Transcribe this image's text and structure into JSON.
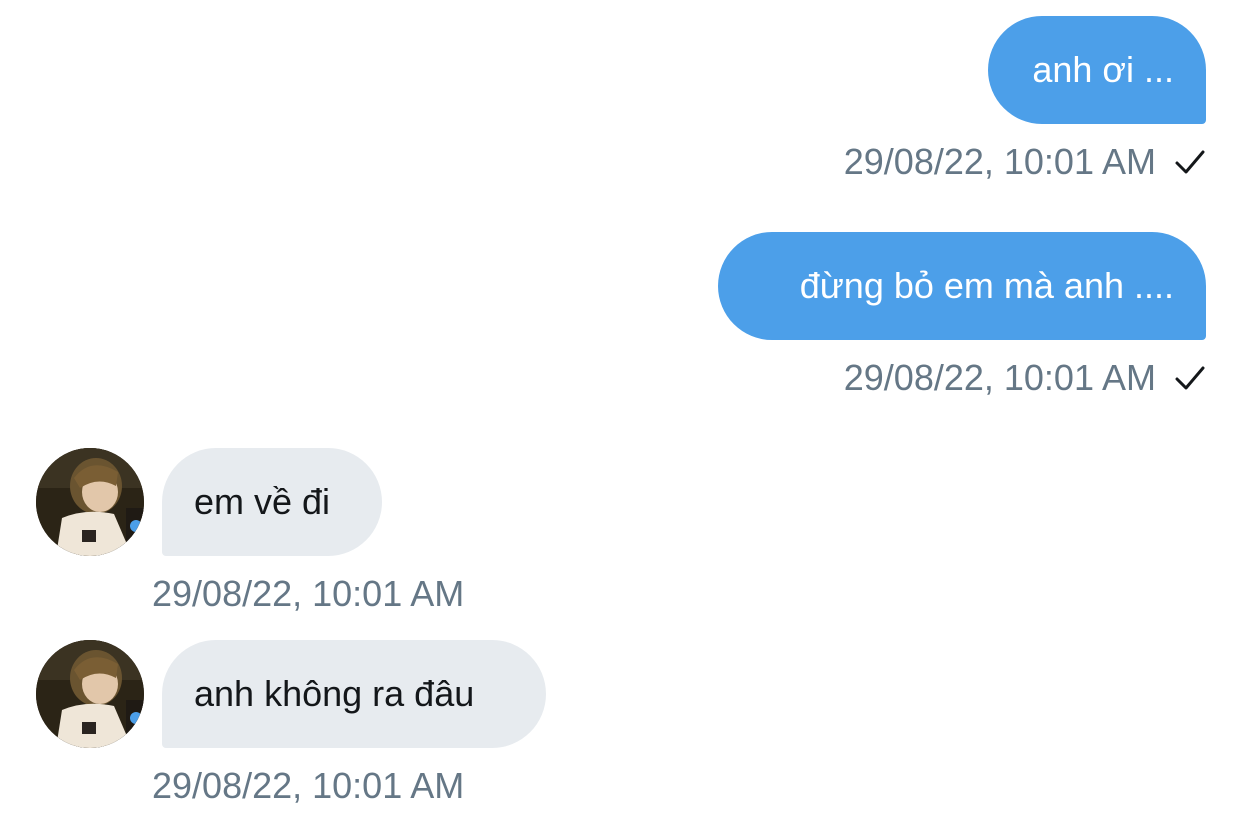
{
  "conversation": {
    "sent_messages": [
      {
        "text": "anh ơi ...",
        "timestamp": "29/08/22, 10:01 AM",
        "status_icon": "checkmark-icon"
      },
      {
        "text": "đừng bỏ em mà anh ....",
        "timestamp": "29/08/22, 10:01 AM",
        "status_icon": "checkmark-icon"
      }
    ],
    "received_messages": [
      {
        "text": "em về đi",
        "timestamp": "29/08/22, 10:01 AM",
        "avatar": "user-avatar"
      },
      {
        "text": "anh không ra đâu",
        "timestamp": "29/08/22, 10:01 AM",
        "avatar": "user-avatar"
      }
    ]
  },
  "colors": {
    "sent_bubble": "#4c9fe9",
    "received_bubble": "#e7ebef",
    "timestamp_text": "#657786",
    "background": "#ffffff"
  }
}
